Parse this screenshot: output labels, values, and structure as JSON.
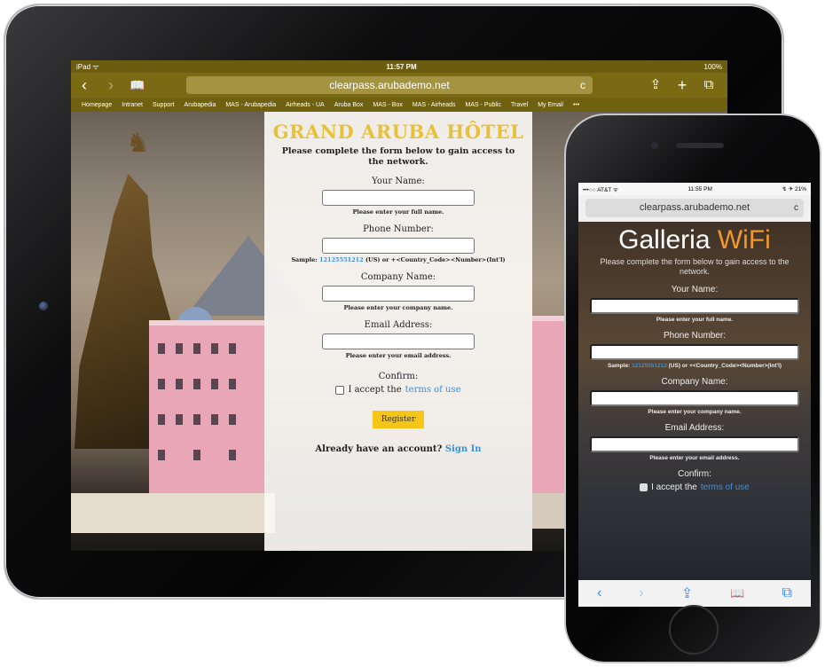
{
  "ipad": {
    "status": {
      "left": "iPad ᯤ",
      "time": "11:57 PM",
      "battery": "100%"
    },
    "nav": {
      "back_icon": "‹",
      "forward_icon": "›",
      "bookmarks_icon": "📖",
      "url": "clearpass.arubademo.net",
      "reload_icon": "c",
      "share_icon": "⇪",
      "add_icon": "+",
      "tabs_icon": "⧉"
    },
    "bookmarks": [
      "Homepage",
      "Intranet",
      "Support",
      "Arubapedia",
      "MAS - Arubapedia",
      "Airheads - UA",
      "Aruba Box",
      "MAS - Box",
      "MAS - Airheads",
      "MAS - Public",
      "Travel",
      "My Email",
      "•••"
    ],
    "form": {
      "title": "GRAND ARUBA HÔTEL",
      "intro": "Please complete the form below to gain access to the network.",
      "name_label": "Your Name:",
      "name_hint": "Please enter your full name.",
      "phone_label": "Phone Number:",
      "phone_hint_prefix": "Sample:",
      "phone_hint_link": "12125551212",
      "phone_hint_suffix": "(US) or +<Country_Code><Number>(Int'l)",
      "company_label": "Company Name:",
      "company_hint": "Please enter your company name.",
      "email_label": "Email Address:",
      "email_hint": "Please enter your email address.",
      "confirm_label": "Confirm:",
      "accept_text": "I accept the",
      "terms_link": "terms of use",
      "register_button": "Register",
      "account_text": "Already have an account?",
      "signin_link": "Sign In"
    }
  },
  "iphone": {
    "status": {
      "carrier": "•••○○ AT&T ᯤ",
      "time": "11:55 PM",
      "battery": "↯ ✈ 21%"
    },
    "url": "clearpass.arubademo.net",
    "reload_icon": "c",
    "form": {
      "title_main": "Galleria",
      "title_accent": "WiFi",
      "intro": "Please complete the form below to gain access to the network.",
      "name_label": "Your Name:",
      "name_hint": "Please enter your full name.",
      "phone_label": "Phone Number:",
      "phone_hint_prefix": "Sample:",
      "phone_hint_link": "12125551212",
      "phone_hint_suffix": "(US) or +<Country_Code><Number>(Int'l)",
      "company_label": "Company Name:",
      "company_hint": "Please enter your company name.",
      "email_label": "Email Address:",
      "email_hint": "Please enter your email address.",
      "confirm_label": "Confirm:",
      "accept_text": "I accept the",
      "terms_link": "terms of use"
    },
    "toolbar": {
      "back": "‹",
      "forward": "›",
      "share": "⇪",
      "bookmarks": "📖",
      "tabs": "⧉"
    }
  }
}
